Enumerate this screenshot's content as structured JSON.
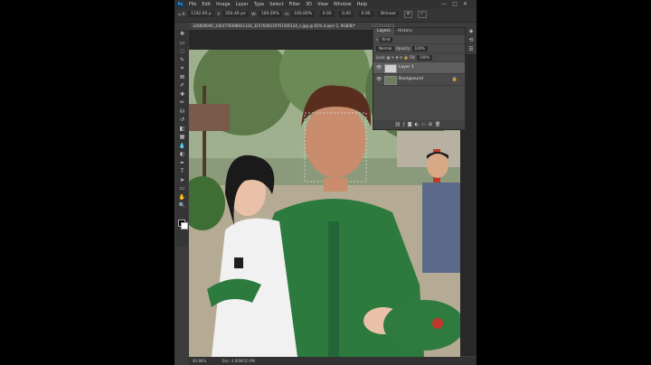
{
  "app": {
    "logo": "Ps",
    "menu": [
      "File",
      "Edit",
      "Image",
      "Layer",
      "Type",
      "Select",
      "Filter",
      "3D",
      "View",
      "Window",
      "Help"
    ],
    "window_buttons": [
      "—",
      "□",
      "✕"
    ]
  },
  "options_bar": {
    "x_label": "X:",
    "x_value": "1192.93 p",
    "y_label": "Y:",
    "y_value": "350.40 px",
    "w_label": "W:",
    "w_value": "100.00%",
    "h_label": "H:",
    "h_value": "100.00%",
    "angle_value": "0.00",
    "h_skew": "0.00",
    "v_skew": "0.00",
    "interpolation": "Bilinear"
  },
  "document": {
    "tab_title": "326600040_3454778398931118_3257640219767295124_n.jpg @ 81% (Layer 1, RGB/8)*",
    "tab_title_2": "2252018052..."
  },
  "toolbar": {
    "tools": [
      "move-tool",
      "marquee-tool",
      "lasso-tool",
      "quick-select-tool",
      "crop-tool",
      "frame-tool",
      "eyedropper-tool",
      "healing-brush-tool",
      "brush-tool",
      "clone-stamp-tool",
      "history-brush-tool",
      "eraser-tool",
      "gradient-tool",
      "blur-tool",
      "dodge-tool",
      "pen-tool",
      "type-tool",
      "path-select-tool",
      "shape-tool",
      "hand-tool",
      "zoom-tool"
    ],
    "glyphs": [
      "✥",
      "▭",
      "◌",
      "✎",
      "⌗",
      "⊠",
      "✐",
      "✚",
      "✏",
      "⛁",
      "↺",
      "◧",
      "▦",
      "💧",
      "◐",
      "✒",
      "T",
      "➤",
      "▭",
      "✋",
      "🔍"
    ]
  },
  "layers_panel": {
    "tabs": [
      "Layers",
      "History"
    ],
    "kind_label": "Kind",
    "blend_mode": "Normal",
    "opacity_label": "Opacity:",
    "opacity_value": "100%",
    "lock_label": "Lock:",
    "fill_label": "Fill:",
    "fill_value": "100%",
    "layers": [
      {
        "name": "Layer 1",
        "visible": true,
        "selected": true
      },
      {
        "name": "Background",
        "visible": true,
        "selected": false,
        "locked": true
      }
    ],
    "footer_icons": [
      "link-icon",
      "fx-icon",
      "mask-icon",
      "adjustment-icon",
      "folder-icon",
      "new-layer-icon",
      "trash-icon"
    ]
  },
  "status": {
    "zoom": "80.88%",
    "doc_size": "Doc: 4.90M/10.9M"
  },
  "colors": {
    "panel_bg": "#3c3c3c",
    "accent": "#31a8ff"
  }
}
